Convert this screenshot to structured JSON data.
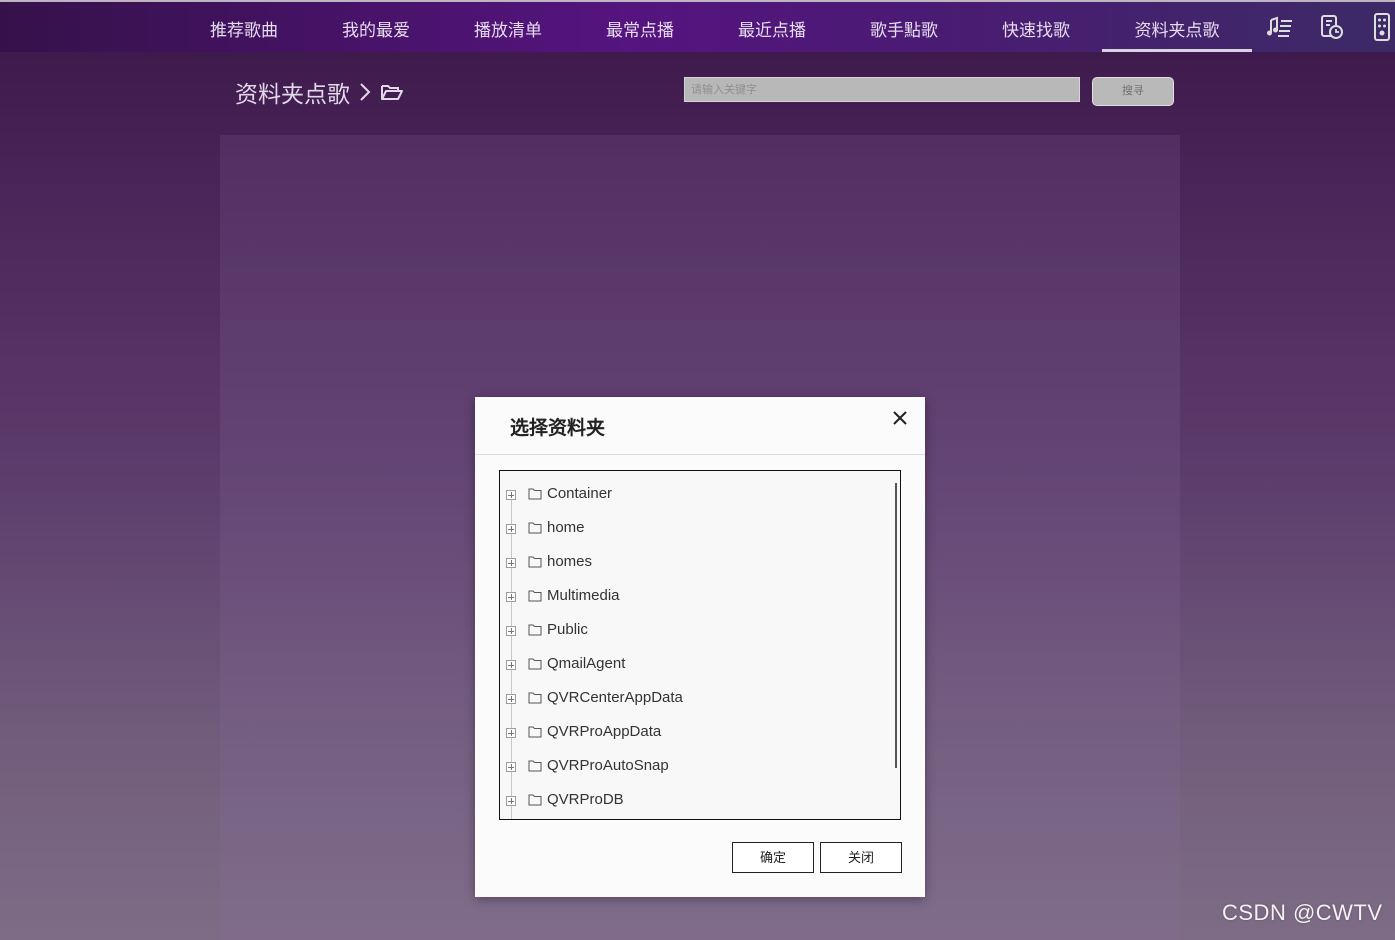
{
  "nav": {
    "items": [
      {
        "label": "推荐歌曲"
      },
      {
        "label": "我的最爱"
      },
      {
        "label": "播放清单"
      },
      {
        "label": "最常点播"
      },
      {
        "label": "最近点播"
      },
      {
        "label": "歌手點歌"
      },
      {
        "label": "快速找歌"
      },
      {
        "label": "资料夹点歌",
        "active": true
      }
    ],
    "icons": [
      "playlist-icon",
      "music-history-icon",
      "remote-icon"
    ]
  },
  "breadcrumb": {
    "title": "资料夹点歌",
    "separator": "›"
  },
  "search": {
    "placeholder": "请输入关键字",
    "button_label": "搜寻"
  },
  "modal": {
    "title": "选择资料夹",
    "tree_items": [
      "Container",
      "home",
      "homes",
      "Multimedia",
      "Public",
      "QmailAgent",
      "QVRCenterAppData",
      "QVRProAppData",
      "QVRProAutoSnap",
      "QVRProDB"
    ],
    "confirm_label": "确定",
    "close_label": "关闭"
  },
  "watermark": "CSDN @CWTV",
  "colors": {
    "accent": "#55147f",
    "modal_bg": "#fbfbfb"
  }
}
